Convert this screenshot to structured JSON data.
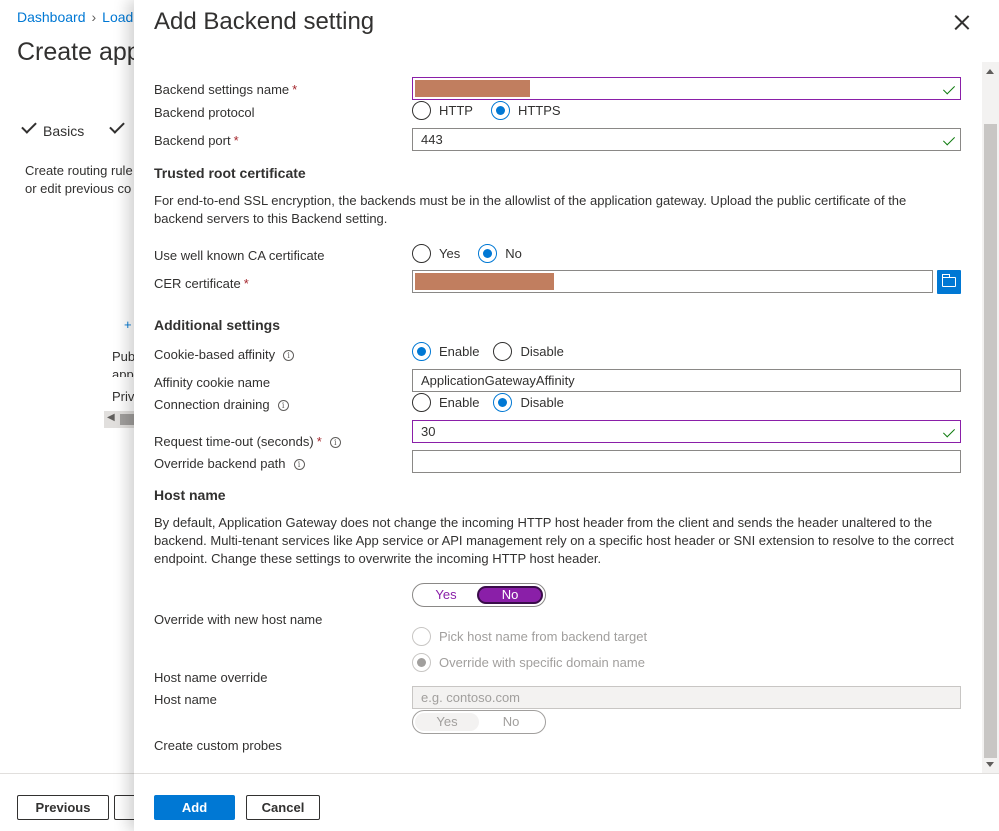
{
  "background": {
    "breadcrumb": [
      "Dashboard",
      "Load"
    ],
    "page_title": "Create app",
    "steps": [
      "Basics"
    ],
    "description": [
      "Create routing rule",
      "or edit previous co"
    ],
    "plus": "+",
    "list": [
      "Pub",
      "app",
      "Priv"
    ],
    "previous_button": "Previous"
  },
  "blade": {
    "title": "Add Backend setting",
    "fields": {
      "settings_name_label": "Backend settings name",
      "protocol_label": "Backend protocol",
      "protocol_http": "HTTP",
      "protocol_https": "HTTPS",
      "protocol_selected": "HTTPS",
      "port_label": "Backend port",
      "port_value": "443"
    },
    "trusted_root": {
      "heading": "Trusted root certificate",
      "description": "For end-to-end SSL encryption, the backends must be in the allowlist of the application gateway. Upload the public certificate of the backend servers to this Backend setting.",
      "use_ca_label": "Use well known CA certificate",
      "use_ca_yes": "Yes",
      "use_ca_no": "No",
      "use_ca_selected": "No",
      "cer_label": "CER certificate"
    },
    "additional": {
      "heading": "Additional settings",
      "cookie_affinity_label": "Cookie-based affinity",
      "cookie_enable": "Enable",
      "cookie_disable": "Disable",
      "cookie_selected": "Enable",
      "affinity_name_label": "Affinity cookie name",
      "affinity_name_value": "ApplicationGatewayAffinity",
      "draining_label": "Connection draining",
      "draining_enable": "Enable",
      "draining_disable": "Disable",
      "draining_selected": "Disable",
      "timeout_label": "Request time-out (seconds)",
      "timeout_value": "30",
      "override_path_label": "Override backend path",
      "override_path_value": ""
    },
    "host": {
      "heading": "Host name",
      "description": "By default, Application Gateway does not change the incoming HTTP host header from the client and sends the header unaltered to the backend. Multi-tenant services like App service or API management rely on a specific host header or SNI extension to resolve to the correct endpoint. Change these settings to overwrite the incoming HTTP host header.",
      "override_label": "Override with new host name",
      "override_yes": "Yes",
      "override_no": "No",
      "override_selected": "No",
      "pick_option": "Pick host name from backend target",
      "specific_option": "Override with specific domain name",
      "host_override_label": "Host name override",
      "host_name_label": "Host name",
      "host_name_placeholder": "e.g. contoso.com",
      "probes_label": "Create custom probes",
      "probes_yes": "Yes",
      "probes_no": "No"
    },
    "buttons": {
      "add": "Add",
      "cancel": "Cancel"
    }
  },
  "colors": {
    "accent": "#0078d4",
    "toggle_active": "#8a1fa8",
    "valid_check": "#107c10",
    "required": "#a4262c",
    "redaction": "#c17e5f"
  }
}
